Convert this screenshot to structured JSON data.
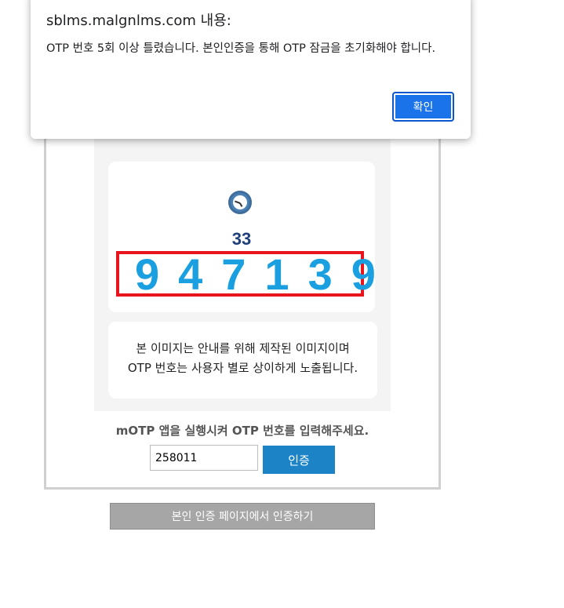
{
  "dialog": {
    "title": "sblms.malgnlms.com 내용:",
    "message": "OTP 번호 5회 이상 틀렸습니다. 본인인증을 통해 OTP 잠금을 초기화해야 합니다.",
    "ok_label": "확인"
  },
  "otp_image": {
    "timer": "33",
    "code": "947139",
    "notice_line1": "본 이미지는 안내를 위해 제작된 이미지이며",
    "notice_line2": "OTP 번호는 사용자 별로 상이하게 노출됩니다."
  },
  "form": {
    "instruction": "mOTP 앱을 실행시켜 OTP 번호를 입력해주세요.",
    "otp_value": "258011",
    "verify_label": "인증",
    "self_auth_label": "본인 인증 페이지에서 인증하기"
  },
  "colors": {
    "otp_digits": "#1aa0e0",
    "highlight_border": "#e8141e",
    "verify_button": "#1c84c6",
    "dialog_button": "#1a73e8"
  }
}
